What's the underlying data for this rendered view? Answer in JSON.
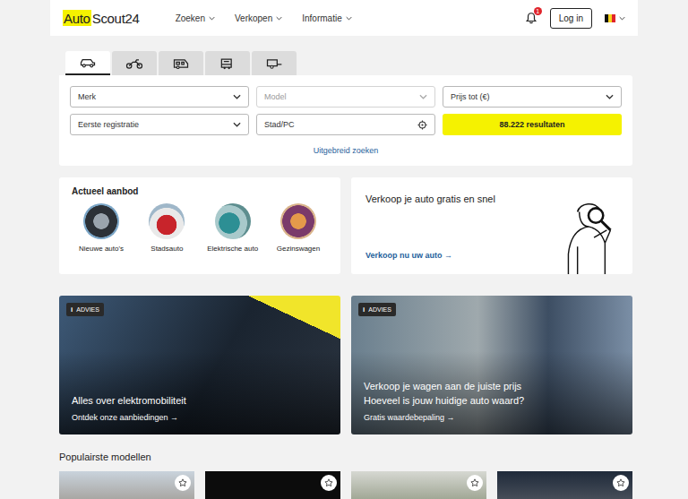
{
  "header": {
    "logo": {
      "highlight": "Auto",
      "rest": "Scout24"
    },
    "nav": [
      {
        "label": "Zoeken"
      },
      {
        "label": "Verkopen"
      },
      {
        "label": "Informatie"
      }
    ],
    "notification_badge": "1",
    "login": "Log in"
  },
  "vehicle_tabs": [
    {
      "kind": "car",
      "selected": true
    },
    {
      "kind": "motorbike",
      "selected": false
    },
    {
      "kind": "camper",
      "selected": false
    },
    {
      "kind": "truck",
      "selected": false
    },
    {
      "kind": "trailer",
      "selected": false
    }
  ],
  "search": {
    "fields": [
      {
        "kind": "select",
        "placeholder": "Merk",
        "disabled": false
      },
      {
        "kind": "select",
        "placeholder": "Model",
        "disabled": true
      },
      {
        "kind": "select",
        "placeholder": "Prijs tot (€)",
        "disabled": false
      },
      {
        "kind": "select",
        "placeholder": "Eerste registratie",
        "disabled": false
      },
      {
        "kind": "input",
        "placeholder": "Stad/PC",
        "disabled": false
      }
    ],
    "submit": "88.222 resultaten",
    "advanced": "Uitgebreid zoeken"
  },
  "offer": {
    "title": "Actueel aanbod",
    "items": [
      {
        "label": "Nieuwe auto's"
      },
      {
        "label": "Stadsauto"
      },
      {
        "label": "Elektrische auto"
      },
      {
        "label": "Gezinswagen"
      }
    ]
  },
  "sell": {
    "title": "Verkoop je auto gratis en snel",
    "link": "Verkoop nu uw auto →"
  },
  "advice_cards": [
    {
      "badge": "ADVIES",
      "title": [
        "Alles over elektromobiliteit"
      ],
      "link": "Ontdek onze aanbiedingen →"
    },
    {
      "badge": "ADVIES",
      "title": [
        "Verkoop je wagen aan de juiste prijs",
        "Hoeveel is jouw huidige auto waard?"
      ],
      "link": "Gratis waardebepaling →"
    }
  ],
  "popular": {
    "title": "Populairste modellen",
    "models": [
      {
        "favorite": false
      },
      {
        "favorite": false
      },
      {
        "favorite": false
      },
      {
        "favorite": false
      }
    ]
  }
}
